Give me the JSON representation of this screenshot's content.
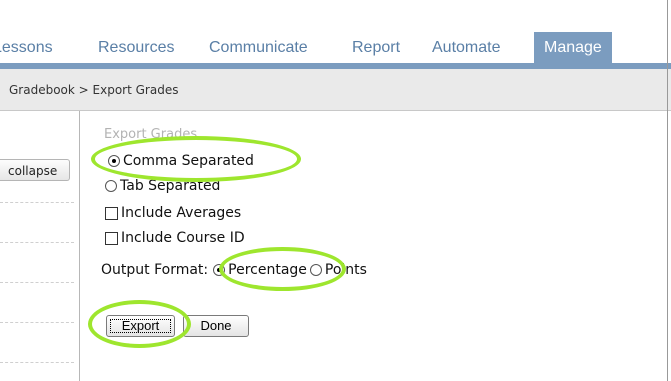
{
  "nav": {
    "tabs": [
      {
        "label": "Lessons",
        "active": false
      },
      {
        "label": "Resources",
        "active": false
      },
      {
        "label": "Communicate",
        "active": false
      },
      {
        "label": "Report",
        "active": false
      },
      {
        "label": "Automate",
        "active": false
      },
      {
        "label": "Manage",
        "active": true
      }
    ]
  },
  "breadcrumb": "Gradebook > Export Grades",
  "left_panel": {
    "collapse_label": "collapse"
  },
  "form": {
    "title": "Export Grades",
    "options": [
      {
        "label": "Comma Separated",
        "type": "radio",
        "selected": true
      },
      {
        "label": "Tab Separated",
        "type": "radio",
        "selected": false
      },
      {
        "label": "Include Averages",
        "type": "checkbox",
        "checked": false
      },
      {
        "label": "Include Course ID",
        "type": "checkbox",
        "checked": false
      }
    ],
    "output_format": {
      "label": "Output Format:",
      "choices": [
        {
          "label": "Percentage",
          "selected": true
        },
        {
          "label": "Points",
          "selected": false
        }
      ]
    },
    "buttons": {
      "export": "Export",
      "done": "Done"
    }
  },
  "colors": {
    "nav_text": "#5a7fa6",
    "nav_active_bg": "#7b9cbf",
    "highlight": "#9ee62e"
  }
}
